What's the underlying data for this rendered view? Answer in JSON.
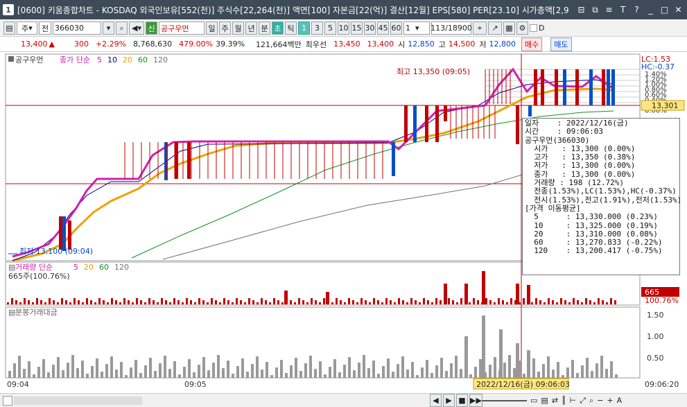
{
  "window": {
    "badge": "1",
    "title": "[0600] 키움종합차트 - KOSDAQ 외국인보유[552(천)] 주식수[22,264(천)] 액면[100] 자본금[22(억)] 결산[12월] EPS[580] PER[23.10] 시가총액[2,9"
  },
  "toolbar": {
    "mode": "주",
    "prefix": "전",
    "code": "366030",
    "name_badge": "신",
    "stock_name": "공구우먼",
    "periods": [
      "일",
      "주",
      "월",
      "년",
      "분",
      "초",
      "틱"
    ],
    "active_period": "초",
    "intervals": [
      "1",
      "3",
      "5",
      "10",
      "15",
      "30",
      "45",
      "60"
    ],
    "active_interval": "1",
    "count": "1",
    "pages": "113/18900",
    "d_label": "D"
  },
  "quote": {
    "price": "13,400",
    "arrow": "▲",
    "change": "300",
    "change_pct": "+2.29%",
    "volume": "8,768,630",
    "vol_ratio": "479.00%",
    "turnover": "39.39%",
    "amount": "121,664백만",
    "priority": "최우선",
    "ask": "13,450",
    "bid": "13,400",
    "open_label": "시",
    "open": "12,850",
    "high_label": "고",
    "high": "14,500",
    "low_label": "저",
    "low": "12,800",
    "buy": "매수",
    "sell": "매도"
  },
  "price_pane": {
    "name": "공구우먼",
    "ma_title": "종가 단순",
    "periods": [
      "5",
      "10",
      "20",
      "60",
      "120"
    ],
    "high_note": "최고 13,350 (09:05)",
    "low_note": "최저 13,100 (09:04)",
    "lc": "LC:1.53",
    "hc": "HC:-0.37",
    "pct_ticks": [
      "1.40%",
      "1.20%",
      "1.00%",
      "0.80%",
      "0.60%",
      "0.40%",
      "0.20%",
      "0.00%"
    ],
    "price_tag": "13,301",
    "ma_colors": [
      "#d020b0",
      "#000080",
      "#f0a000",
      "#139020",
      "#707070"
    ]
  },
  "volume_pane": {
    "title": "거래량 단순",
    "periods": [
      "5",
      "20",
      "60",
      "120"
    ],
    "sub": "665주(100.76%)",
    "tag1": "665",
    "tag2": "100.76%"
  },
  "amount_pane": {
    "title": "분봉거래대금",
    "ticks": [
      "1.50",
      "1.00",
      "0.50"
    ]
  },
  "x_axis": {
    "left": "09:04",
    "mid": "09:05",
    "right": "09:06:20",
    "cursor": "2022/12/16(금) 09:06:03"
  },
  "infobox": {
    "lines": [
      "일자    : 2022/12/16(금)",
      "시간    : 09:06:03",
      "공구우먼(366030)",
      "  시가   : 13,300 (0.00%)",
      "  고가   : 13,350 (0.38%)",
      "  저가   : 13,300 (0.00%)",
      "  종가   : 13,300 (0.00%)",
      "  거래량 : 198 (12.72%)",
      "  전종(1.53%),LC(1.53%),HC(-0.37%)",
      "  전시(1.53%),전고(1.91%),전저(1.53%)",
      "[가격 이동평균]",
      "  5      : 13,330.000 (0.23%)",
      "  10     : 13,325.000 (0.19%)",
      "  20     : 13,310.000 (0.08%)",
      "  60     : 13,270.833 (-0.22%)",
      "  120    : 13,200.417 (-0.75%)"
    ]
  },
  "icons": {
    "minimize": "minimize-icon",
    "restore": "restore-icon",
    "close": "close-icon",
    "search": "search-icon",
    "speaker": "speaker-icon",
    "settings": "gear-icon"
  }
}
